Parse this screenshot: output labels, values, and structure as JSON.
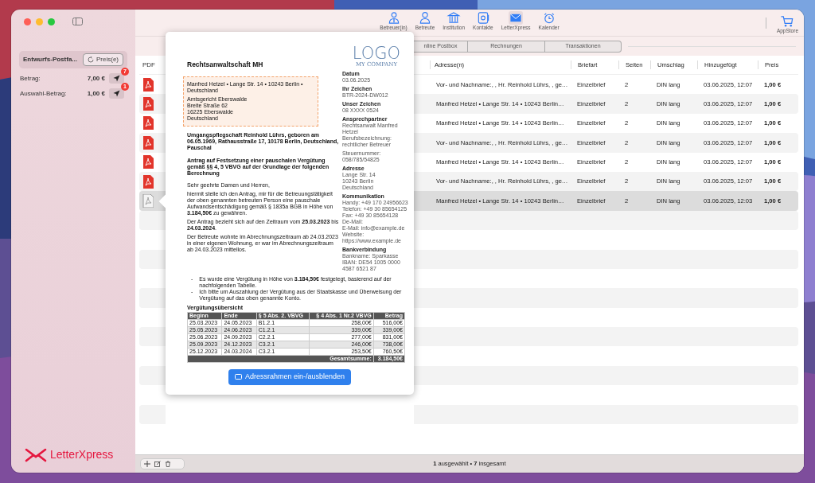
{
  "toolbar": {
    "items": [
      {
        "label": "Betreuer(in)",
        "kind": "guardian",
        "selected": false
      },
      {
        "label": "Betreute",
        "kind": "person",
        "selected": false
      },
      {
        "label": "Institution",
        "kind": "building",
        "selected": false
      },
      {
        "label": "Kontakte",
        "kind": "contacts",
        "selected": false
      },
      {
        "label": "LetterXpress",
        "kind": "envelope",
        "selected": true
      },
      {
        "label": "Kalender",
        "kind": "clock",
        "selected": false
      }
    ],
    "store": {
      "label": "AppStore"
    }
  },
  "sidebar": {
    "mailbox": {
      "label": "Entwurfs-Postfa...",
      "button": "Preis(e)"
    },
    "amounts": [
      {
        "label": "Betrag:",
        "value": "7,00 €",
        "badge": "7"
      },
      {
        "label": "Auswahl-Betrag:",
        "value": "1,00 €",
        "badge": "1"
      }
    ],
    "brand": "LetterXpress"
  },
  "tabs": [
    {
      "label": "nline Postbox",
      "selected": false
    },
    {
      "label": "Rechnungen",
      "selected": false
    },
    {
      "label": "Transaktionen",
      "selected": false
    }
  ],
  "table": {
    "columns": [
      "PDF",
      "Adresse(n)",
      "Briefart",
      "Seiten",
      "Umschlag",
      "Hinzugefügt",
      "Preis"
    ],
    "rows": [
      {
        "address": "Vor- und Nachname:, , Hr. Reinhold Lührs, , ge…",
        "type": "Einzelbrief",
        "pages": "2",
        "envelope": "DIN lang",
        "added": "03.06.2025, 12:07",
        "price": "1,00 €",
        "selected": false
      },
      {
        "address": "Manfred Hetzel • Lange Str. 14 • 10243 Berlin…",
        "type": "Einzelbrief",
        "pages": "2",
        "envelope": "DIN lang",
        "added": "03.06.2025, 12:07",
        "price": "1,00 €",
        "selected": false
      },
      {
        "address": "Manfred Hetzel • Lange Str. 14 • 10243 Berlin…",
        "type": "Einzelbrief",
        "pages": "2",
        "envelope": "DIN lang",
        "added": "03.06.2025, 12:07",
        "price": "1,00 €",
        "selected": false
      },
      {
        "address": "Vor- und Nachname:, , Hr. Reinhold Lührs, , ge…",
        "type": "Einzelbrief",
        "pages": "2",
        "envelope": "DIN lang",
        "added": "03.06.2025, 12:07",
        "price": "1,00 €",
        "selected": false
      },
      {
        "address": "Manfred Hetzel • Lange Str. 14 • 10243 Berlin…",
        "type": "Einzelbrief",
        "pages": "2",
        "envelope": "DIN lang",
        "added": "03.06.2025, 12:07",
        "price": "1,00 €",
        "selected": false
      },
      {
        "address": "Vor- und Nachname:, , Hr. Reinhold Lührs, , ge…",
        "type": "Einzelbrief",
        "pages": "2",
        "envelope": "DIN lang",
        "added": "03.06.2025, 12:07",
        "price": "1,00 €",
        "selected": false
      },
      {
        "address": "Manfred Hetzel • Lange Str. 14 • 10243 Berlin…",
        "type": "Einzelbrief",
        "pages": "2",
        "envelope": "DIN lang",
        "added": "03.06.2025, 12:03",
        "price": "1,00 €",
        "selected": true
      }
    ]
  },
  "preview": {
    "document": {
      "firm": "Rechtsanwaltschaft MH",
      "logo": {
        "title": "LOGO",
        "subtitle": "MY COMPANY"
      },
      "sender_line": "Manfred Hetzel • Lange Str. 14 • 10243 Berlin • Deutschland",
      "recipient": [
        "Amtsgericht Eberswalde",
        "Breite Straße 62",
        "16225 Eberswalde",
        "Deutschland"
      ],
      "subject": "Umgangspflegschaft Reinhold Lührs, geboren am 06.05.1969, Rathausstraße 17, 10178 Berlin, Deutschland, Pauschal",
      "heading": "Antrag auf Festsetzung einer pauschalen Vergütung gemäß §§ 4, 5 VBVG auf der Grundlage der folgenden Berechnung",
      "greeting": "Sehr geehrte Damen und Herren,",
      "paragraphs": [
        "hiermit stelle ich den Antrag, mir für die Betreuungstätigkeit der oben genannten betreuten Person eine pauschale Aufwandsentschädigung gemäß § 1835a BGB in Höhe von **3.184,50€** zu gewähren.",
        "Der Antrag bezieht sich auf den Zeitraum vom **25.03.2023** bis **24.03.2024**.",
        "Der Betreute wohnte im Abrechnungszeitraum ab 24.03.2023 in einer eigenen Wohnung, er war im Abrechnungszeitraum ab 24.03.2023 mittellos."
      ],
      "bullets": [
        {
          "marker": "-",
          "text": "Es wurde eine Vergütung in Höhe von **3.184,50€** festgelegt, basierend auf der nachfolgenden Tabelle."
        },
        {
          "marker": "-",
          "text": "Ich bitte um Auszahlung der Vergütung aus der Staatskasse und Überweisung der Vergütung auf das oben genannte Konto."
        }
      ],
      "info": [
        {
          "heading": "Datum",
          "lines": [
            "03.06.2025"
          ]
        },
        {
          "heading": "Ihr Zeichen",
          "lines": [
            "BTR-2024-DW012"
          ]
        },
        {
          "heading": "Unser Zeichen",
          "lines": [
            "08 XXXX 0524"
          ]
        },
        {
          "heading": "Ansprechpartner",
          "lines": [
            "Rechtsanwalt Manfred Hetzel",
            "Berufsbezeichnung: rechtlicher Betreuer"
          ]
        },
        {
          "lines": [
            "Steuernummer: 058/785/54825"
          ]
        },
        {
          "heading": "Adresse",
          "lines": [
            "Lange Str. 14",
            "10243 Berlin",
            "Deutschland"
          ]
        },
        {
          "heading": "Kommunikation",
          "lines": [
            "Handy: +49 170 24956623",
            "Telefon: +49 30 85654125",
            "Fax: +49 30 85654128",
            "De-Mail:",
            "E-Mail: info@example.de",
            "Website: https://www.example.de"
          ]
        },
        {
          "heading": "Bankverbindung",
          "lines": [
            "Bankname: Sparkasse",
            "IBAN: DE54 1005 0000 4587 6521 87"
          ]
        }
      ],
      "table_title": "Vergütungsübersicht",
      "table_columns": [
        "Beginn",
        "Ende",
        "§ 5 Abs. 2. VBVG",
        "§ 4 Abs. 1 Nr.2 VBVG",
        "Betrag"
      ],
      "table_rows": [
        [
          "25.03.2023",
          "24.05.2023",
          "B1.2.1",
          "258,00€",
          "516,00€"
        ],
        [
          "25.05.2023",
          "24.06.2023",
          "C1.2.1",
          "339,00€",
          "339,00€"
        ],
        [
          "25.06.2023",
          "24.09.2023",
          "C2.2.1",
          "277,00€",
          "831,00€"
        ],
        [
          "25.09.2023",
          "24.12.2023",
          "C3.2.1",
          "246,00€",
          "738,00€"
        ],
        [
          "25.12.2023",
          "24.03.2024",
          "C3.2.1",
          "253,50€",
          "760,50€"
        ]
      ],
      "total_label": "Gesamtsumme:",
      "total": "3.184,50€"
    },
    "button": "Adressrahmen ein-/ausblenden"
  },
  "status_bar": {
    "summary": "**1** ausgewählt • **7** insgesamt"
  }
}
